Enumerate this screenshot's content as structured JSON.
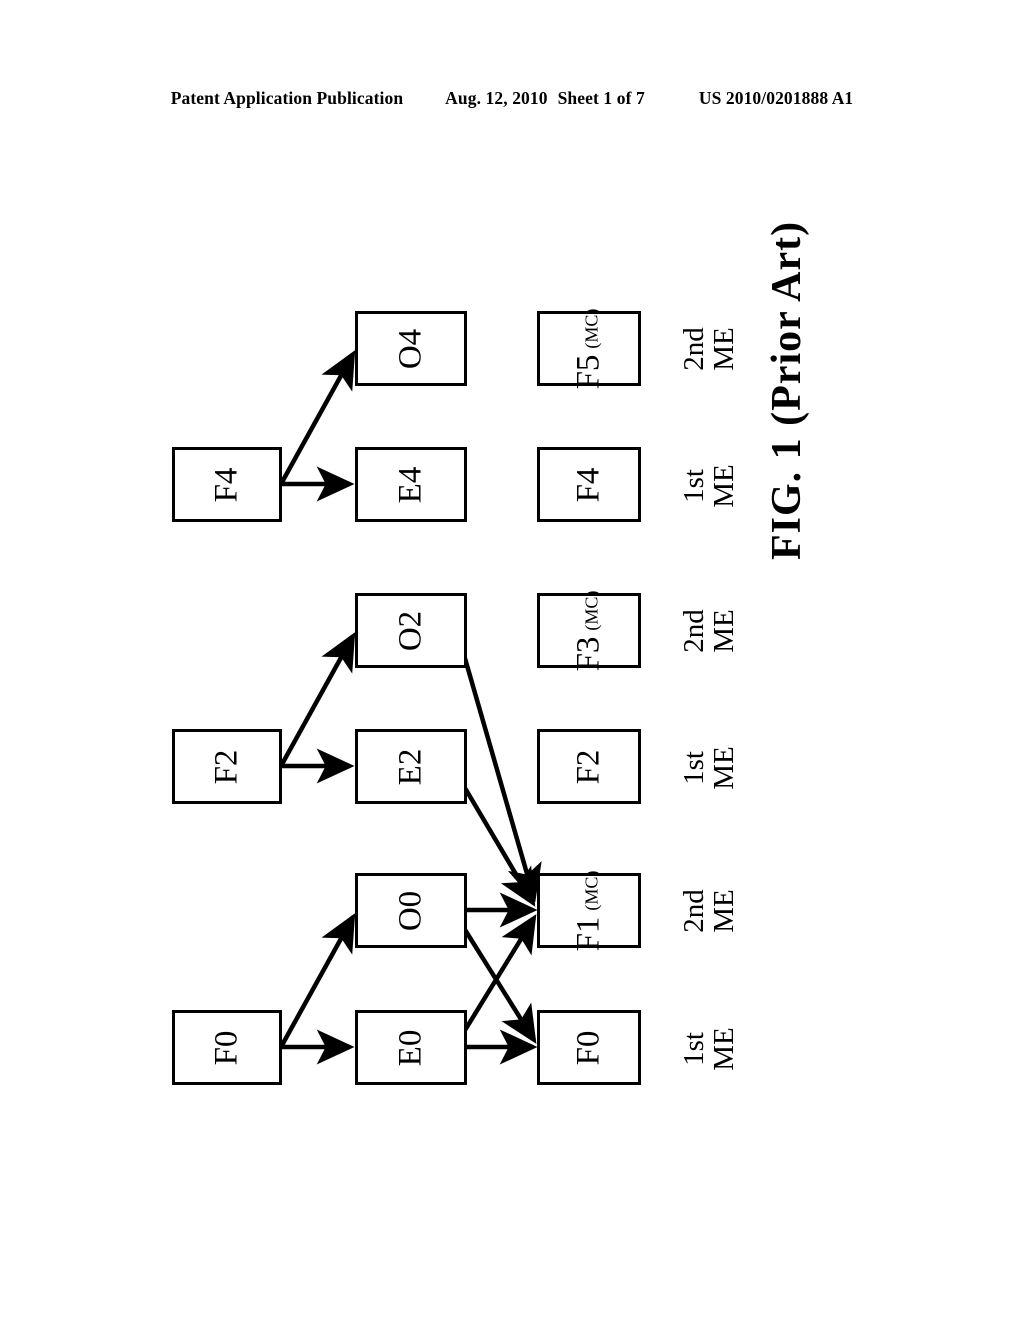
{
  "header": {
    "publication": "Patent Application Publication",
    "date": "Aug. 12, 2010",
    "sheet": "Sheet 1 of 7",
    "number": "US 2010/0201888 A1"
  },
  "figure": {
    "caption": "FIG. 1 (Prior Art)",
    "colors": {
      "ink": "#000000",
      "paper": "#ffffff"
    },
    "boxes": [
      {
        "id": "f4-src",
        "main": "F4",
        "sub": ""
      },
      {
        "id": "f2-src",
        "main": "F2",
        "sub": ""
      },
      {
        "id": "f0-src",
        "main": "F0",
        "sub": ""
      },
      {
        "id": "o4",
        "main": "O4",
        "sub": ""
      },
      {
        "id": "e4",
        "main": "E4",
        "sub": ""
      },
      {
        "id": "o2",
        "main": "O2",
        "sub": ""
      },
      {
        "id": "e2",
        "main": "E2",
        "sub": ""
      },
      {
        "id": "o0",
        "main": "O0",
        "sub": ""
      },
      {
        "id": "e0",
        "main": "E0",
        "sub": ""
      },
      {
        "id": "f5-res",
        "main": "F5",
        "sub": "(MC)"
      },
      {
        "id": "f4-res",
        "main": "F4",
        "sub": ""
      },
      {
        "id": "f3-res",
        "main": "F3",
        "sub": "(MC)"
      },
      {
        "id": "f2-res",
        "main": "F2",
        "sub": ""
      },
      {
        "id": "f1-res",
        "main": "F1",
        "sub": "(MC)"
      },
      {
        "id": "f0-res",
        "main": "F0",
        "sub": ""
      }
    ],
    "me_labels": [
      {
        "id": "me-f5",
        "line1": "2nd",
        "line2": "ME"
      },
      {
        "id": "me-f4",
        "line1": "1st",
        "line2": "ME"
      },
      {
        "id": "me-f3",
        "line1": "2nd",
        "line2": "ME"
      },
      {
        "id": "me-f2",
        "line1": "1st",
        "line2": "ME"
      },
      {
        "id": "me-f1",
        "line1": "2nd",
        "line2": "ME"
      },
      {
        "id": "me-f0",
        "line1": "1st",
        "line2": "ME"
      }
    ],
    "arrows": [
      {
        "id": "f4-to-o4",
        "from": "f4-src",
        "to": "o4"
      },
      {
        "id": "f4-to-e4",
        "from": "f4-src",
        "to": "e4"
      },
      {
        "id": "f2-to-o2",
        "from": "f2-src",
        "to": "o2"
      },
      {
        "id": "f2-to-e2",
        "from": "f2-src",
        "to": "e2"
      },
      {
        "id": "f0-to-o0",
        "from": "f0-src",
        "to": "o0"
      },
      {
        "id": "f0-to-e0",
        "from": "f0-src",
        "to": "e0"
      },
      {
        "id": "o2-to-f1",
        "from": "o2",
        "to": "f1-res"
      },
      {
        "id": "e2-to-f1",
        "from": "e2",
        "to": "f1-res"
      },
      {
        "id": "o0-to-f1",
        "from": "o0",
        "to": "f1-res"
      },
      {
        "id": "o0-to-f0",
        "from": "o0",
        "to": "f0-res"
      },
      {
        "id": "e0-to-f1",
        "from": "e0",
        "to": "f1-res"
      },
      {
        "id": "e0-to-f0",
        "from": "e0",
        "to": "f0-res"
      }
    ]
  }
}
